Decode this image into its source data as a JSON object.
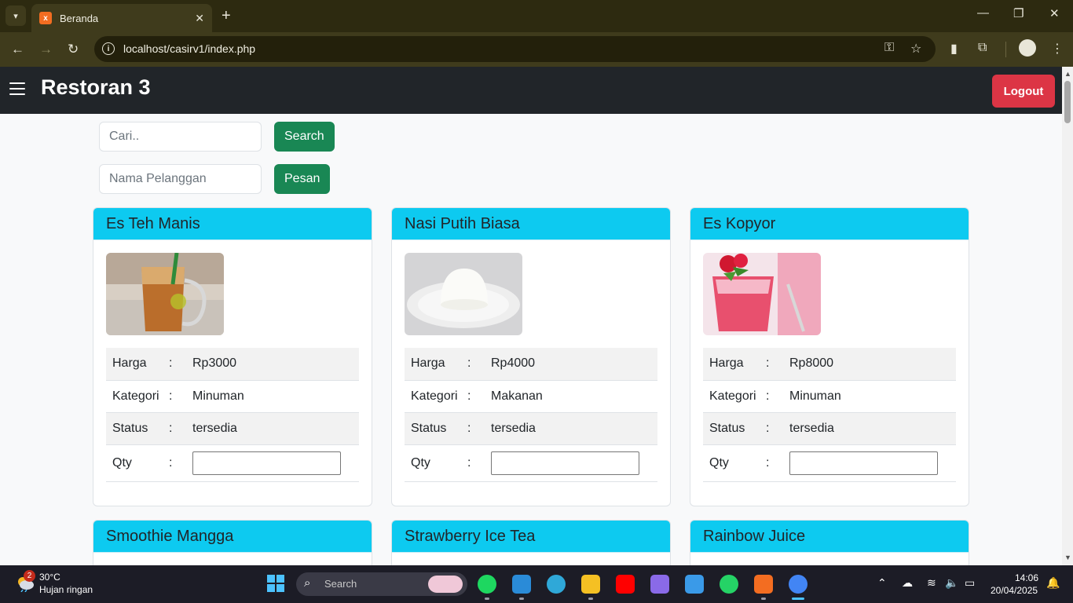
{
  "browser": {
    "tab_title": "Beranda",
    "url": "localhost/casirv1/index.php",
    "icons": [
      "tab-search-icon",
      "close-icon",
      "new-tab-icon",
      "minimize-icon",
      "maximize-icon",
      "window-close-icon",
      "back-icon",
      "forward-icon",
      "reload-icon",
      "site-info-icon",
      "password-key-icon",
      "bookmark-star-icon",
      "clipboard-icon",
      "extensions-icon",
      "profile-avatar-icon",
      "menu-kebab-icon"
    ]
  },
  "navbar": {
    "brand": "Restoran 3",
    "logout_label": "Logout"
  },
  "search": {
    "placeholder": "Cari..",
    "button_label": "Search"
  },
  "order": {
    "placeholder": "Nama Pelanggan",
    "button_label": "Pesan"
  },
  "labels": {
    "harga": "Harga",
    "kategori": "Kategori",
    "status": "Status",
    "qty": "Qty",
    "colon": ":"
  },
  "menu_items": [
    {
      "name": "Es Teh Manis",
      "harga": "Rp3000",
      "kategori": "Minuman",
      "status": "tersedia"
    },
    {
      "name": "Nasi Putih Biasa",
      "harga": "Rp4000",
      "kategori": "Makanan",
      "status": "tersedia"
    },
    {
      "name": "Es Kopyor",
      "harga": "Rp8000",
      "kategori": "Minuman",
      "status": "tersedia"
    },
    {
      "name": "Smoothie Mangga"
    },
    {
      "name": "Strawberry Ice Tea"
    },
    {
      "name": "Rainbow Juice"
    }
  ],
  "taskbar": {
    "weather_badge": "2",
    "temperature": "30°C",
    "weather_desc": "Hujan ringan",
    "search_label": "Search",
    "time": "14:06",
    "date": "20/04/2025"
  },
  "colors": {
    "navbar": "#212529",
    "card_header": "#0dcaf0",
    "success": "#198754",
    "danger": "#dc3545"
  }
}
